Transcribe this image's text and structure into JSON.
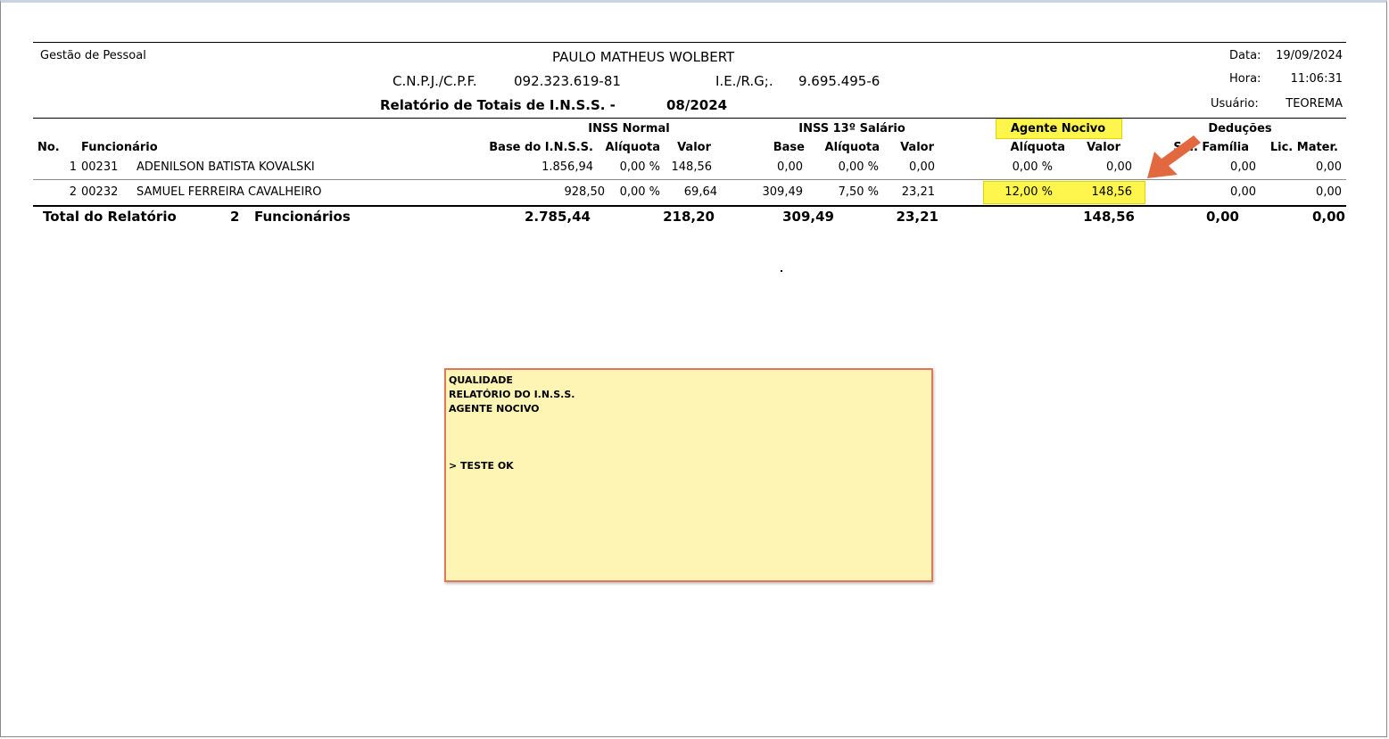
{
  "header": {
    "module": "Gestão de Pessoal",
    "company": "PAULO MATHEUS WOLBERT",
    "cnpj_label": "C.N.P.J./C.P.F.",
    "cnpj_value": "092.323.619-81",
    "ie_label": "I.E./R.G;.",
    "ie_value": "9.695.495-6",
    "report_title": "Relatório de Totais de I.N.S.S. -",
    "period": "08/2024",
    "date_label": "Data:",
    "date_value": "19/09/2024",
    "time_label": "Hora:",
    "time_value": "11:06:31",
    "user_label": "Usuário:",
    "user_value": "TEOREMA"
  },
  "groups": {
    "inss_normal": "INSS Normal",
    "inss_13": "INSS 13º Salário",
    "agente_nocivo": "Agente Nocivo",
    "deducoes": "Deduções"
  },
  "columns": {
    "no": "No.",
    "funcionario": "Funcionário",
    "base_inss": "Base do I.N.S.S.",
    "aliquota": "Alíquota",
    "valor": "Valor",
    "base13": "Base",
    "aliquota13": "Alíquota",
    "valor13": "Valor",
    "aliquota_an": "Alíquota",
    "valor_an": "Valor",
    "sal_familia": "Sal. Família",
    "lic_mater": "Lic. Mater."
  },
  "rows": [
    {
      "no": "1",
      "codigo": "00231",
      "nome": "ADENILSON  BATISTA KOVALSKI",
      "base": "1.856,94",
      "aliq": "0,00 %",
      "valor": "148,56",
      "base13": "0,00",
      "aliq13": "0,00 %",
      "valor13": "0,00",
      "aliq_an": "0,00 %",
      "valor_an": "0,00",
      "sal_familia": "0,00",
      "lic_mater": "0,00"
    },
    {
      "no": "2",
      "codigo": "00232",
      "nome": "SAMUEL FERREIRA CAVALHEIRO",
      "base": "928,50",
      "aliq": "0,00 %",
      "valor": "69,64",
      "base13": "309,49",
      "aliq13": "7,50 %",
      "valor13": "23,21",
      "aliq_an": "12,00 %",
      "valor_an": "148,56",
      "sal_familia": "0,00",
      "lic_mater": "0,00"
    }
  ],
  "totals": {
    "label": "Total do Relatório",
    "count": "2",
    "count_label": "Funcionários",
    "base": "2.785,44",
    "valor": "218,20",
    "base13": "309,49",
    "valor13": "23,21",
    "valor_an": "148,56",
    "sal_familia": "0,00",
    "lic_mater": "0,00"
  },
  "note": {
    "lines": [
      "QUALIDADE",
      "RELATÓRIO DO I.N.S.S.",
      "AGENTE NOCIVO",
      "",
      "",
      "",
      "> TESTE OK"
    ]
  },
  "colors": {
    "highlight": "#fff200",
    "arrow": "#e2693f",
    "note_bg": "#fef5b5",
    "note_border": "#e0765a"
  }
}
